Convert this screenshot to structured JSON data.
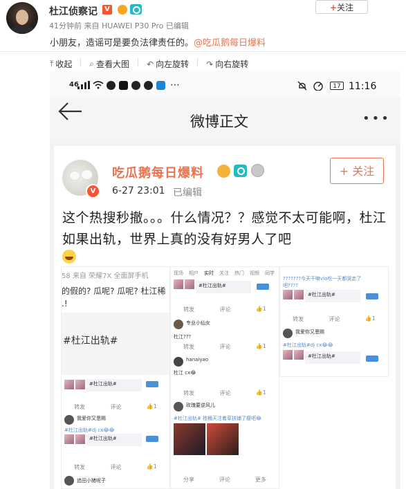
{
  "post": {
    "author": "杜江侦察记",
    "verified_badge": "V",
    "meta": "41分钟前  来自 HUAWEI P30 Pro   已编辑",
    "follow_label": "关注",
    "text": "小朋友，造谣可是要负法律责任的。",
    "mention": "@吃瓜鹅每日爆料"
  },
  "toolbar": {
    "items": [
      {
        "icon": "collapse-icon",
        "glyph": "⤒",
        "label": "收起"
      },
      {
        "icon": "zoom-icon",
        "glyph": "⌕",
        "label": "查看大图"
      },
      {
        "icon": "rotate-left-icon",
        "glyph": "↶",
        "label": "向左旋转"
      },
      {
        "icon": "rotate-right-icon",
        "glyph": "↷",
        "label": "向右旋转"
      }
    ]
  },
  "embedded": {
    "status": {
      "signal": "46",
      "time": "11:16",
      "battery": "17"
    },
    "nav_title": "微博正文",
    "author": "吃瓜鹅每日爆料",
    "date": "6-27 23:01",
    "edited": "已编辑",
    "follow_label": "+ 关注",
    "body": "这个热搜秒撤。。。什么情况？？感觉不太可能啊，杜江如果出轨，世界上真的没有好男人了吧",
    "collage": {
      "p1": {
        "meta": "58  来自 荣耀7X 全面屏手机",
        "line1": "的假的? 瓜呢? 瓜呢? 杜江稀",
        "line2": ".!",
        "hashtag": "#杜江出轨#",
        "mini_tag": "#杜江出轨#",
        "user1": "我爱你又恩赐",
        "user1_text": "#杜江出轨#dj cx😂😂",
        "mini_tag2": "#杜江出轨#",
        "user2": "追田小猪呢子",
        "forward": "转发",
        "comment": "评论"
      },
      "p2": {
        "tabs": [
          "现场",
          "相户",
          "实时",
          "关注",
          "热门",
          "视频",
          "同学"
        ],
        "tag": "#杜江出轨#",
        "user1": "专业小仙女",
        "user1_text": "杜江???",
        "user2": "hanaiyao",
        "user2_text": "杜江 cx😂",
        "user3": "玫瑰要逆风儿",
        "user3_text": "#杜江出轨# 桂桶天注着草扶铺了瘦吧😂",
        "forward": "转发",
        "comment": "评论",
        "share": "分享",
        "more": "更多"
      },
      "p3": {
        "line1": "???????今天干嘛vlo吃一天都哭走了",
        "line2": "吧????",
        "tag1": "#杜江出轨#",
        "user": "我爱你又恩赐",
        "user_text": "#杜江出轨#dj cx😂😂",
        "tag2": "#杜江出轨#",
        "forward": "转发",
        "comment": "评论"
      }
    }
  }
}
